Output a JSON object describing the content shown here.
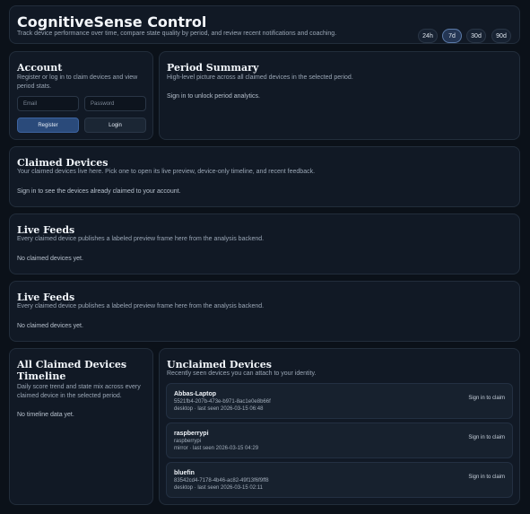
{
  "header": {
    "title": "CognitiveSense Control",
    "subtitle": "Track device performance over time, compare state quality by period, and review recent notifications and coaching.",
    "ranges": [
      "24h",
      "7d",
      "30d",
      "90d"
    ],
    "active_range": "7d"
  },
  "account": {
    "title": "Account",
    "subtitle": "Register or log in to claim devices and view period stats.",
    "email_placeholder": "Email",
    "password_placeholder": "Password",
    "register_label": "Register",
    "login_label": "Login"
  },
  "period_summary": {
    "title": "Period Summary",
    "subtitle": "High-level picture across all claimed devices in the selected period.",
    "message": "Sign in to unlock period analytics."
  },
  "claimed_devices": {
    "title": "Claimed Devices",
    "subtitle": "Your claimed devices live here. Pick one to open its live preview, device-only timeline, and recent feedback.",
    "message": "Sign in to see the devices already claimed to your account."
  },
  "live_feeds_1": {
    "title": "Live Feeds",
    "subtitle": "Every claimed device publishes a labeled preview frame here from the analysis backend.",
    "message": "No claimed devices yet."
  },
  "live_feeds_2": {
    "title": "Live Feeds",
    "subtitle": "Every claimed device publishes a labeled preview frame here from the analysis backend.",
    "message": "No claimed devices yet."
  },
  "timeline": {
    "title_line1": "All Claimed Devices",
    "title_line2": "Timeline",
    "subtitle": "Daily score trend and state mix across every claimed device in the selected period.",
    "message": "No timeline data yet."
  },
  "unclaimed": {
    "title": "Unclaimed Devices",
    "subtitle": "Recently seen devices you can attach to your identity.",
    "devices": [
      {
        "name": "Abbas-Laptop",
        "id": "5521fb4-207b-473e-b971-8ac1e0e8b66f",
        "meta": "desktop · last seen 2026-03-15 06:48",
        "action": "Sign in to claim"
      },
      {
        "name": "raspberrypi",
        "id": "raspberrypi",
        "meta": "mirror · last seen 2026-03-15 04:29",
        "action": "Sign in to claim"
      },
      {
        "name": "bluefin",
        "id": "83542cd4-7178-4b46-ac82-49f13f6f9ff8",
        "meta": "desktop · last seen 2026-03-15 02:11",
        "action": "Sign in to claim"
      }
    ]
  }
}
